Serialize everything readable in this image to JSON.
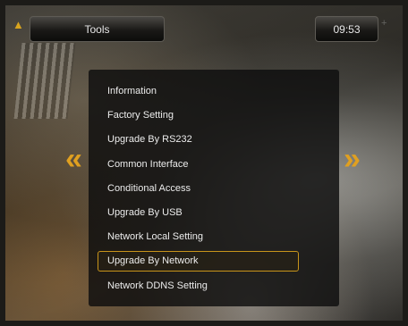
{
  "header": {
    "brand_mark": "▲",
    "title": "Tools",
    "time": "09:53",
    "time_ghost": "+"
  },
  "nav": {
    "left_arrow": "«",
    "right_arrow": "»"
  },
  "menu": {
    "selected_index": 7,
    "items": [
      {
        "label": "Information"
      },
      {
        "label": "Factory Setting"
      },
      {
        "label": "Upgrade By RS232"
      },
      {
        "label": "Common Interface"
      },
      {
        "label": "Conditional Access"
      },
      {
        "label": "Upgrade By USB"
      },
      {
        "label": "Network Local Setting"
      },
      {
        "label": "Upgrade By Network"
      },
      {
        "label": "Network DDNS Setting"
      }
    ]
  },
  "colors": {
    "accent": "#e0a020",
    "highlight_border": "#c8941a",
    "text": "#ececec"
  }
}
